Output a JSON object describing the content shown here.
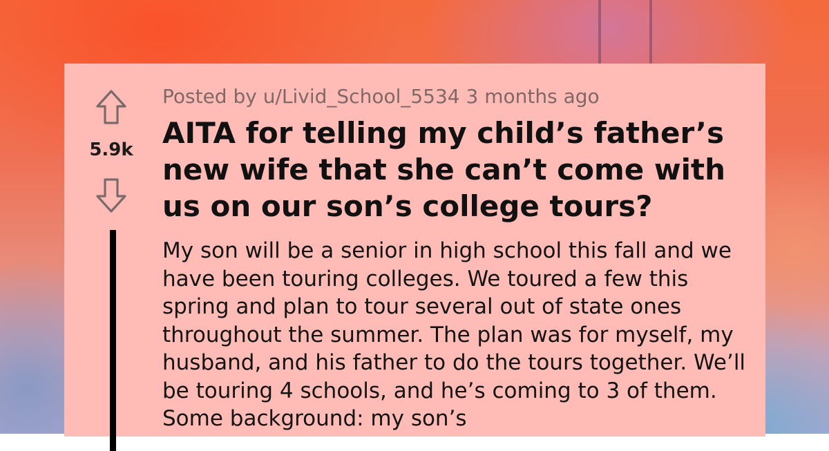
{
  "post": {
    "posted_by": "Posted by u/Livid_School_5534 3 months ago",
    "title": "AITA for telling my child’s father’s new wife that she can’t come with us on our son’s college tours?",
    "votes": "5.9k",
    "body": "My son will be a senior in high school this fall and we have been touring colleges. We toured a few this spring and plan to tour several out of state ones throughout the summer. The plan was for myself, my husband, and his father to do the tours together. We’ll be touring 4 schools, and he’s coming to 3 of them. Some background: my son’s"
  },
  "icons": {
    "upvote": "arrow-up-icon",
    "downvote": "arrow-down-icon"
  },
  "colors": {
    "card_background": "#ffbbb5",
    "text": "#141414",
    "meta_text": "#7f6866",
    "arrow_stroke": "#7a6a68"
  }
}
